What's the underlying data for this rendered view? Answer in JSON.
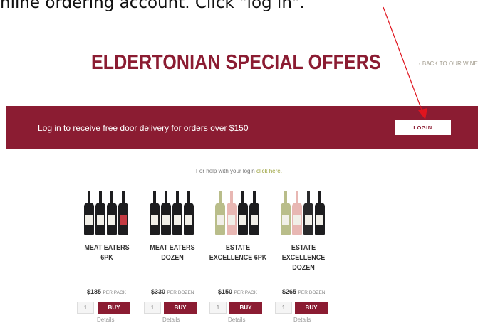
{
  "instruction": "nline ordering account. Click \"log in\".",
  "header": {
    "title": "ELDERTONIAN SPECIAL OFFERS",
    "back_link": "‹ BACK TO OUR WINE"
  },
  "banner": {
    "login_link": "Log in",
    "message": " to receive free door delivery for orders over $150",
    "login_button": "LOGIN"
  },
  "help": {
    "text": "For help with your login ",
    "link": "click here."
  },
  "colors": {
    "brand": "#8b1c32",
    "arrow": "#e0141e"
  },
  "products": [
    {
      "name_line1": "MEAT EATERS",
      "name_line2": "6PK",
      "name_line3": "",
      "price": "$185",
      "unit": "PER PACK",
      "qty": "1",
      "buy": "BUY",
      "details": "Details",
      "bottle_colors": [
        "#1d1d1f",
        "#1d1d1f",
        "#1d1d1f",
        "#1d1d1f"
      ]
    },
    {
      "name_line1": "MEAT EATERS",
      "name_line2": "DOZEN",
      "name_line3": "",
      "price": "$330",
      "unit": "PER DOZEN",
      "qty": "1",
      "buy": "BUY",
      "details": "Details",
      "bottle_colors": [
        "#1d1d1f",
        "#1d1d1f",
        "#1d1d1f",
        "#1d1d1f"
      ]
    },
    {
      "name_line1": "ESTATE",
      "name_line2": "EXCELLENCE 6PK",
      "name_line3": "",
      "price": "$150",
      "unit": "PER PACK",
      "qty": "1",
      "buy": "BUY",
      "details": "Details",
      "bottle_colors": [
        "#b9bd8a",
        "#e8b7b3",
        "#1d1d1f",
        "#1d1d1f"
      ]
    },
    {
      "name_line1": "ESTATE",
      "name_line2": "EXCELLENCE",
      "name_line3": "DOZEN",
      "price": "$265",
      "unit": "PER DOZEN",
      "qty": "1",
      "buy": "BUY",
      "details": "Details",
      "bottle_colors": [
        "#b9bd8a",
        "#e8b7b3",
        "#2a2a2c",
        "#1d1d1f"
      ]
    }
  ]
}
